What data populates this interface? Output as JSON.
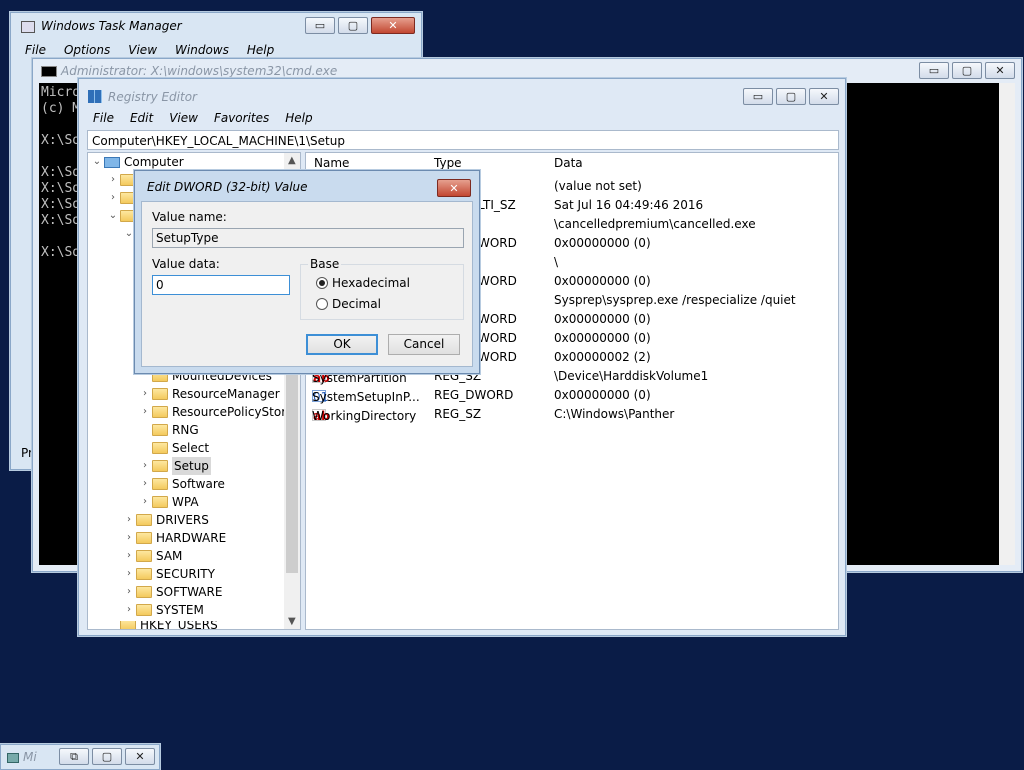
{
  "task_manager": {
    "title": "Windows Task Manager",
    "menu": [
      "File",
      "Options",
      "View",
      "Windows",
      "Help"
    ],
    "status_fragment": "Pr"
  },
  "cmd": {
    "title": "Administrator: X:\\windows\\system32\\cmd.exe",
    "lines": [
      "Micro",
      "(c) M",
      "",
      "X:\\So",
      "",
      "X:\\So",
      "X:\\So",
      "X:\\So",
      "X:\\So",
      "",
      "X:\\So"
    ]
  },
  "regedit": {
    "title": "Registry Editor",
    "menu": [
      "File",
      "Edit",
      "View",
      "Favorites",
      "Help"
    ],
    "address": "Computer\\HKEY_LOCAL_MACHINE\\1\\Setup",
    "tree": {
      "root": "Computer",
      "children": [
        "MountedDevices",
        "ResourceManager",
        "ResourcePolicyStore",
        "RNG",
        "Select",
        "Setup",
        "Software",
        "WPA"
      ],
      "hives": [
        "DRIVERS",
        "HARDWARE",
        "SAM",
        "SECURITY",
        "SOFTWARE",
        "SYSTEM"
      ],
      "partial": "HKEY_USERS"
    },
    "columns": {
      "name": "Name",
      "type": "Type",
      "data": "Data"
    },
    "rows": [
      {
        "name": "",
        "type": "",
        "data": "(value not set)"
      },
      {
        "name": "",
        "type": "LTI_SZ",
        "data": "Sat Jul 16 04:49:46 2016"
      },
      {
        "name": "",
        "type": "",
        "data": "\\cancelledpremium\\cancelled.exe"
      },
      {
        "name": "",
        "type": "WORD",
        "data": "0x00000000 (0)"
      },
      {
        "name": "",
        "type": "",
        "data": "\\"
      },
      {
        "name": "",
        "type": "WORD",
        "data": "0x00000000 (0)"
      },
      {
        "name": "",
        "type": "",
        "data": "Sysprep\\sysprep.exe /respecialize /quiet"
      },
      {
        "name": "",
        "type": "WORD",
        "data": "0x00000000 (0)"
      },
      {
        "name": "",
        "type": "WORD",
        "data": "0x00000000 (0)"
      },
      {
        "name": "",
        "type": "WORD",
        "data": "0x00000002 (2)"
      },
      {
        "name": "SystemPartition",
        "type": "REG_SZ",
        "data": "\\Device\\HarddiskVolume1",
        "icon": "ab"
      },
      {
        "name": "SystemSetupInP...",
        "type": "REG_DWORD",
        "data": "0x00000000 (0)",
        "icon": "bin"
      },
      {
        "name": "WorkingDirectory",
        "type": "REG_SZ",
        "data": "C:\\Windows\\Panther",
        "icon": "ab"
      }
    ]
  },
  "dialog": {
    "title": "Edit DWORD (32-bit) Value",
    "value_name_label": "Value name:",
    "value_name": "SetupType",
    "value_data_label": "Value data:",
    "value_data": "0",
    "base_label": "Base",
    "hex_label": "Hexadecimal",
    "dec_label": "Decimal",
    "ok": "OK",
    "cancel": "Cancel"
  },
  "minimized": {
    "title": "Mi"
  },
  "glyphs": {
    "minimize": "▭",
    "maximize": "▢",
    "close": "✕",
    "restore": "⧉"
  }
}
